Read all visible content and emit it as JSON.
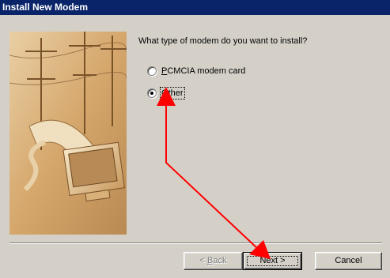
{
  "window": {
    "title": "Install New Modem"
  },
  "wizard": {
    "question": "What type of modem do you want to install?"
  },
  "options": [
    {
      "label": "PCMCIA modem card",
      "selected": false
    },
    {
      "label": "Other",
      "selected": true
    }
  ],
  "buttons": {
    "back": {
      "accel": "B",
      "rest": "ack",
      "prefix": "< ",
      "enabled": false
    },
    "next": {
      "label": "Next >"
    },
    "cancel": {
      "label": "Cancel"
    }
  },
  "annotation": {
    "color": "#ff0000"
  }
}
